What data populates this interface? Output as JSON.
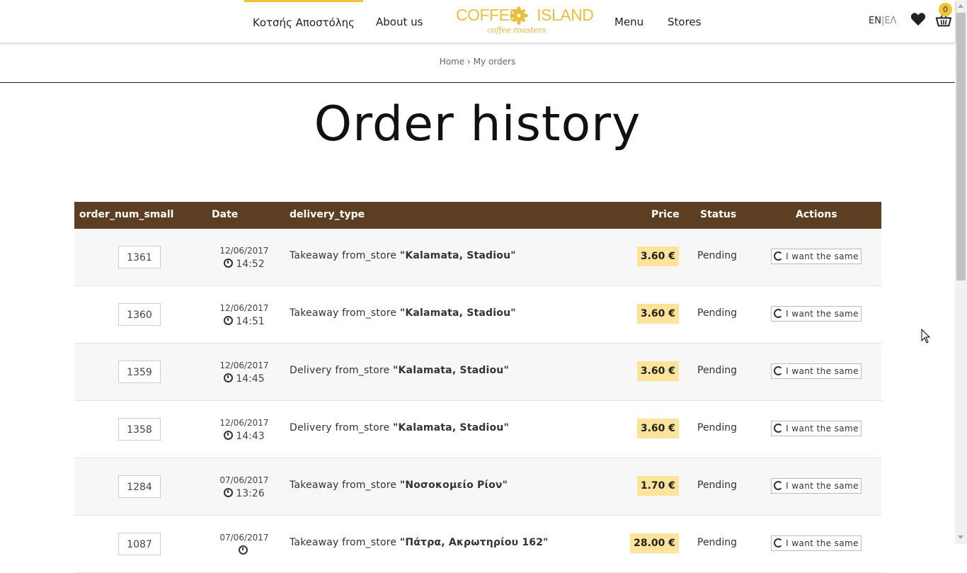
{
  "header": {
    "user_name": "Κοτσής Αποστόλης",
    "nav": {
      "about": "About us",
      "menu": "Menu",
      "stores": "Stores"
    },
    "logo": {
      "top_left": "COFFEE",
      "top_right": "ISLAND",
      "sub": "coffee roasters"
    },
    "lang": {
      "en": "EN",
      "sep": "|",
      "el": "ΕΛ"
    },
    "cart_count": "0"
  },
  "breadcrumb": {
    "home": "Home",
    "sep": "›",
    "current": "My orders"
  },
  "page": {
    "title": "Order history"
  },
  "table": {
    "headers": {
      "order": "order_num_small",
      "date": "Date",
      "delivery": "delivery_type",
      "price": "Price",
      "status": "Status",
      "actions": "Actions"
    },
    "action_label": "I want the same",
    "rows": [
      {
        "order": "1361",
        "date": "12/06/2017",
        "time": "14:52",
        "type": "Takeaway from_store",
        "store": "\"Kalamata, Stadiou\"",
        "price": "3.60 €",
        "status": "Pending"
      },
      {
        "order": "1360",
        "date": "12/06/2017",
        "time": "14:51",
        "type": "Takeaway from_store",
        "store": "\"Kalamata, Stadiou\"",
        "price": "3.60 €",
        "status": "Pending"
      },
      {
        "order": "1359",
        "date": "12/06/2017",
        "time": "14:45",
        "type": "Delivery from_store",
        "store": "\"Kalamata, Stadiou\"",
        "price": "3.60 €",
        "status": "Pending"
      },
      {
        "order": "1358",
        "date": "12/06/2017",
        "time": "14:43",
        "type": "Delivery from_store",
        "store": "\"Kalamata, Stadiou\"",
        "price": "3.60 €",
        "status": "Pending"
      },
      {
        "order": "1284",
        "date": "07/06/2017",
        "time": "13:26",
        "type": "Takeaway from_store",
        "store": "\"Νοσοκομείο Ρίον\"",
        "price": "1.70 €",
        "status": "Pending"
      },
      {
        "order": "1087",
        "date": "07/06/2017",
        "time": "",
        "type": "Takeaway from_store",
        "store": "\"Πάτρα, Ακρωτηρίου 162\"",
        "price": "28.00 €",
        "status": "Pending"
      }
    ]
  },
  "colors": {
    "accent": "#f2c434",
    "table_header": "#5d3e23",
    "price_bg": "#fde49a"
  }
}
